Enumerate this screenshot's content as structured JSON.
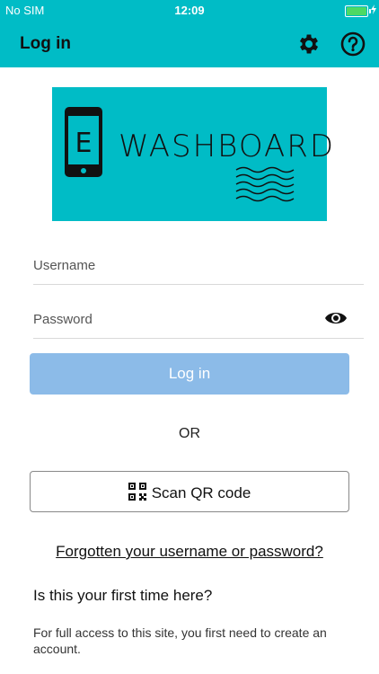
{
  "status_bar": {
    "carrier": "No SIM",
    "time": "12:09",
    "battery_color": "#4cd964"
  },
  "nav": {
    "title": "Log in",
    "settings_icon": "gear-icon",
    "help_icon": "help-icon"
  },
  "logo": {
    "letter": "E",
    "wordmark": "WASHBOARD"
  },
  "form": {
    "username_placeholder": "Username",
    "username_value": "",
    "password_placeholder": "Password",
    "password_value": "",
    "login_label": "Log in",
    "or_label": "OR",
    "qr_label": "Scan QR code"
  },
  "links": {
    "forgot": "Forgotten your username or password?"
  },
  "signup": {
    "heading": "Is this your first time here?",
    "text": "For full access to this site, you first need to create an account."
  },
  "colors": {
    "brand": "#00bcc6",
    "button_disabled": "#8cbbe8"
  }
}
